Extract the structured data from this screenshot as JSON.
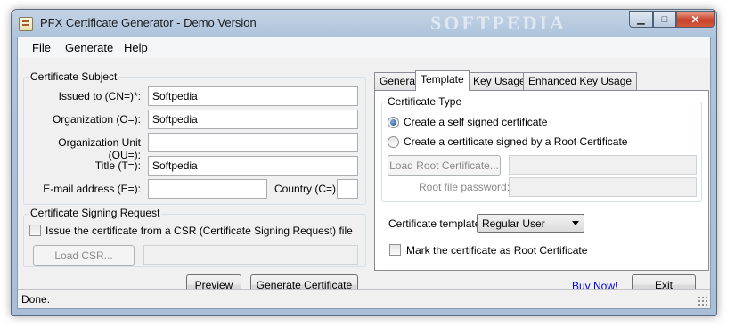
{
  "window": {
    "title": "PFX Certificate Generator - Demo Version",
    "watermark": "SOFTPEDIA",
    "minimize_glyph": "▁",
    "maximize_glyph": "□",
    "close_glyph": "✕"
  },
  "menu": [
    "File",
    "Generate",
    "Help"
  ],
  "subject": {
    "title": "Certificate Subject",
    "issued_to_label": "Issued to (CN=)*:",
    "issued_to_value": "Softpedia",
    "organization_label": "Organization (O=):",
    "organization_value": "Softpedia",
    "org_unit_label": "Organization Unit (OU=):",
    "org_unit_value": "",
    "title_label": "Title (T=):",
    "title_value": "Softpedia",
    "email_label": "E-mail address (E=):",
    "email_value": "",
    "country_label": "Country (C=):",
    "country_value": ""
  },
  "csr": {
    "title": "Certificate Signing Request",
    "checkbox_label": "Issue the certificate from a CSR (Certificate Signing Request) file",
    "load_button": "Load CSR...",
    "path_value": ""
  },
  "actions": {
    "preview": "Preview",
    "generate": "Generate Certificate",
    "buy_now": "Buy Now!",
    "exit": "Exit"
  },
  "tabs": [
    {
      "label": "General",
      "active": false
    },
    {
      "label": "Template",
      "active": true
    },
    {
      "label": "Key Usage",
      "active": false
    },
    {
      "label": "Enhanced Key Usage",
      "active": false
    }
  ],
  "template": {
    "cert_type_title": "Certificate Type",
    "self_signed_label": "Create a self signed certificate",
    "root_signed_label": "Create a certificate signed by a Root Certificate",
    "selected_type": "self_signed",
    "load_root_button": "Load Root Certificate...",
    "root_path_value": "",
    "root_password_label": "Root file password:",
    "root_password_value": "",
    "cert_template_label": "Certificate template:",
    "cert_template_value": "Regular User",
    "mark_root_label": "Mark the certificate as Root Certificate"
  },
  "status": {
    "text": "Done."
  }
}
